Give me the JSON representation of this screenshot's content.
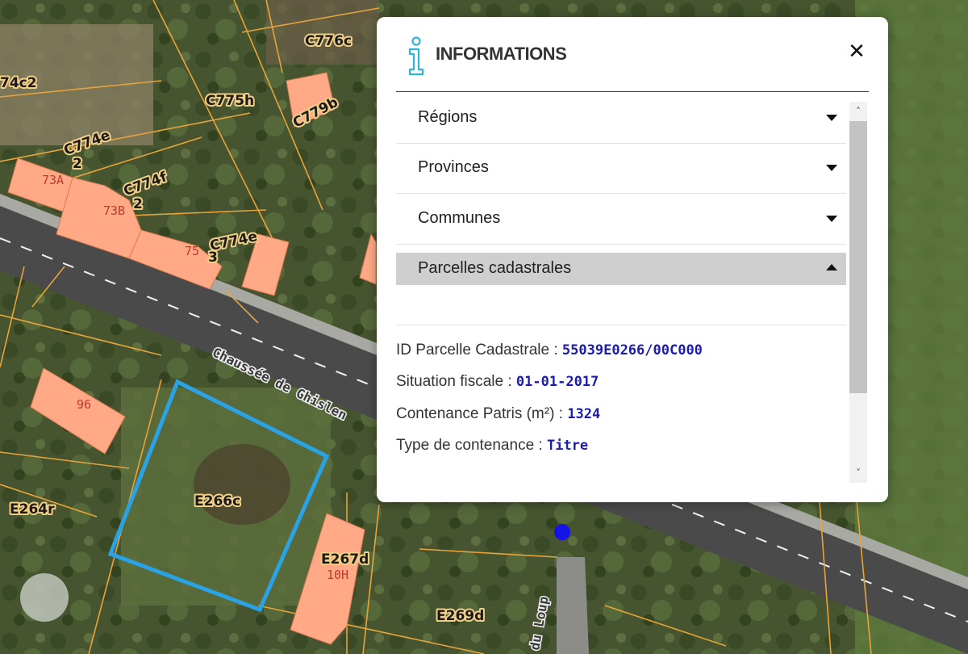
{
  "popup": {
    "icon": "info-icon",
    "title": "INFORMATIONS",
    "close_icon": "close-icon",
    "close_glyph": "✕"
  },
  "accordion": [
    {
      "label": "Régions",
      "expanded": false
    },
    {
      "label": "Provinces",
      "expanded": false
    },
    {
      "label": "Communes",
      "expanded": false
    },
    {
      "label": "Parcelles cadastrales",
      "expanded": true
    }
  ],
  "parcel": {
    "id_label": "ID Parcelle Cadastrale : ",
    "id_value": "55039E0266/00C000",
    "fiscal_label": "Situation fiscale : ",
    "fiscal_value": "01-01-2017",
    "area_label": "Contenance Patris (m²) : ",
    "area_value": "1324",
    "type_label": "Type de contenance : ",
    "type_value": "Titre"
  },
  "scrollbar": {
    "up_glyph": "˄",
    "down_glyph": "˅"
  },
  "map": {
    "parcel_labels": [
      "C776c",
      "C775h",
      "C779b",
      "C774e",
      "2",
      "C774f",
      "2",
      "C774e",
      "3",
      "74c2",
      "E264r",
      "E266c",
      "E267d",
      "E269d"
    ],
    "house_numbers": [
      "73A",
      "73B",
      "75",
      "96",
      "10H"
    ],
    "street_names": [
      "Chaussée de Ghislen",
      "du Loup"
    ],
    "colors": {
      "building": "#ffa987",
      "parcel_line": "#e8a43a",
      "selection": "#2aa3e6",
      "marker": "#1414e6",
      "road": "#4a4a4a",
      "road_marking": "#f0f0f0"
    }
  }
}
